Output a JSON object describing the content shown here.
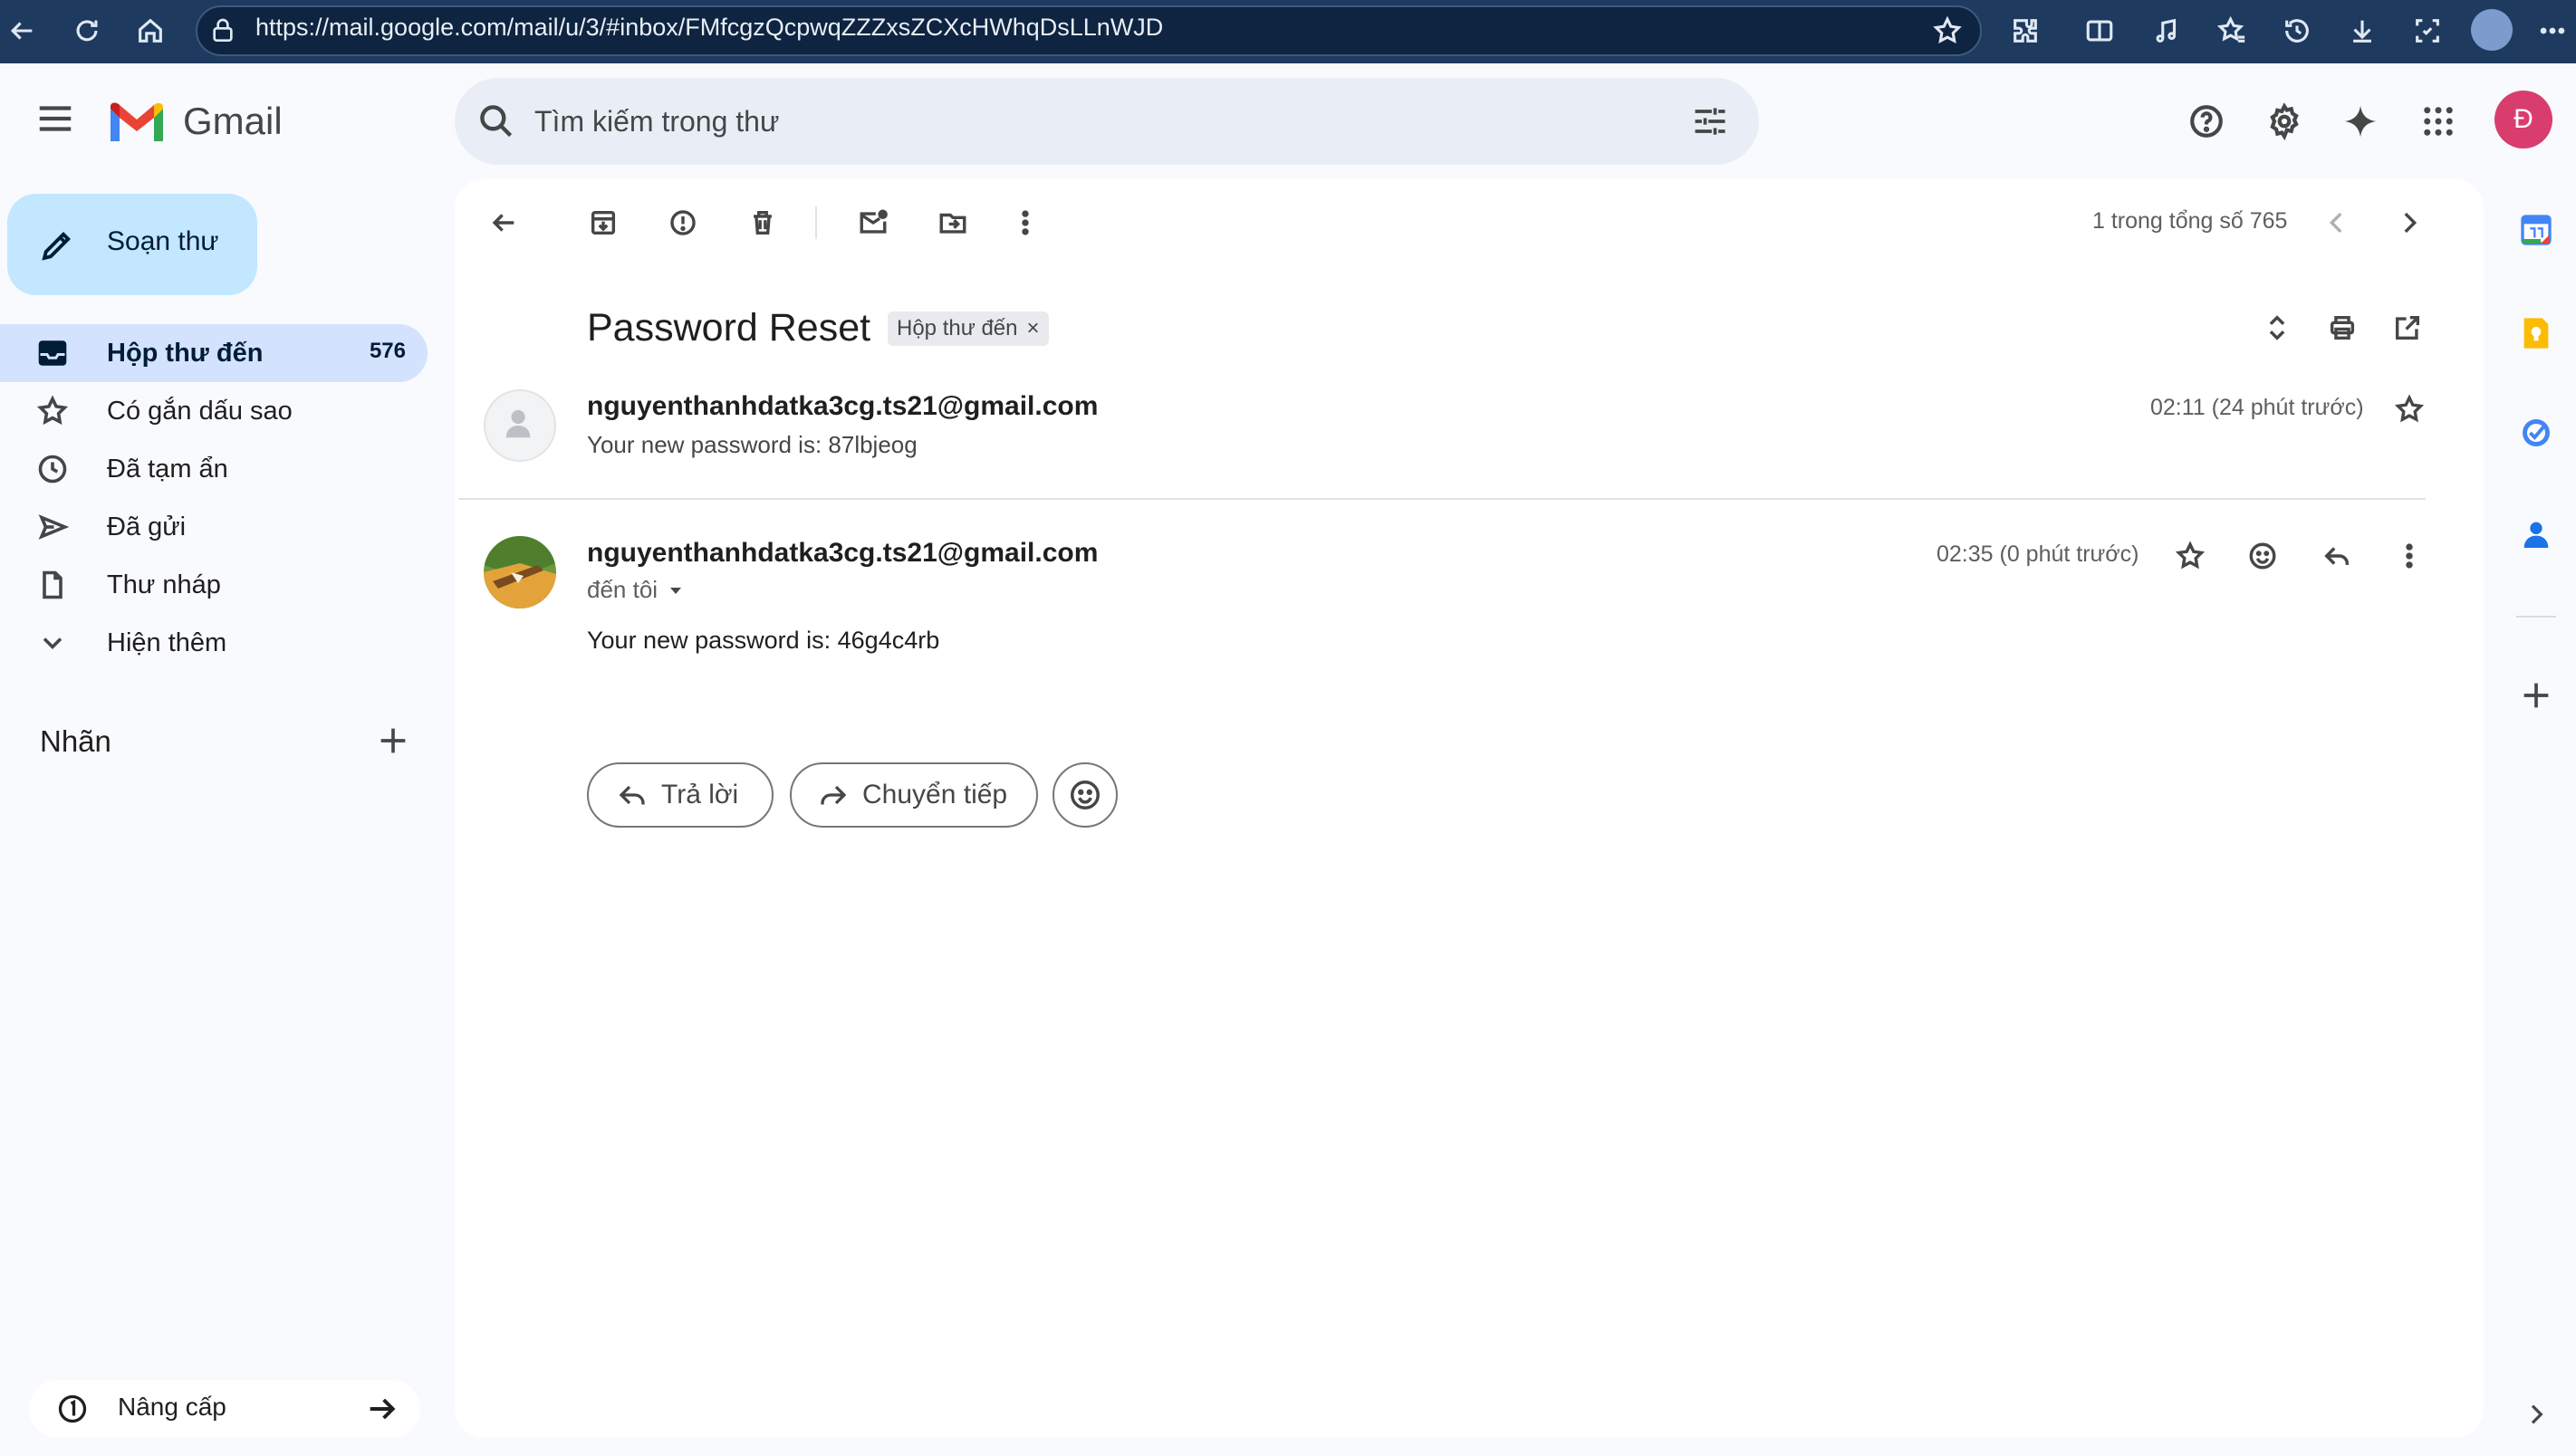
{
  "browser": {
    "url": "https://mail.google.com/mail/u/3/#inbox/FMfcgzQcpwqZZZxsZCXcHWhqDsLLnWJD"
  },
  "app": {
    "name": "Gmail",
    "search_placeholder": "Tìm kiếm trong thư",
    "account_initial": "Đ"
  },
  "sidebar": {
    "compose_label": "Soạn thư",
    "items": [
      {
        "label": "Hộp thư đến",
        "count": "576",
        "active": true
      },
      {
        "label": "Có gắn dấu sao"
      },
      {
        "label": "Đã tạm ẩn"
      },
      {
        "label": "Đã gửi"
      },
      {
        "label": "Thư nháp"
      },
      {
        "label": "Hiện thêm"
      }
    ],
    "labels_title": "Nhãn",
    "upgrade_label": "Nâng cấp"
  },
  "toolbar": {
    "pager": "1 trong tổng số 765"
  },
  "thread": {
    "subject": "Password Reset",
    "chip_label": "Hộp thư đến",
    "chip_close": "×",
    "messages": [
      {
        "sender": "nguyenthanhdatka3cg.ts21@gmail.com",
        "snippet": "Your new password is: 87lbjeog",
        "time": "02:11 (24 phút trước)"
      },
      {
        "sender": "nguyenthanhdatka3cg.ts21@gmail.com",
        "recipient": "đến tôi",
        "time": "02:35 (0 phút trước)",
        "body": "Your new password is: 46g4c4rb"
      }
    ],
    "reply_label": "Trả lời",
    "forward_label": "Chuyển tiếp"
  },
  "colors": {
    "browser_bar": "#1e3a5f",
    "compose_bg": "#c2e7ff",
    "active_nav": "#d3e3fd",
    "avatar": "#d93d6e"
  }
}
